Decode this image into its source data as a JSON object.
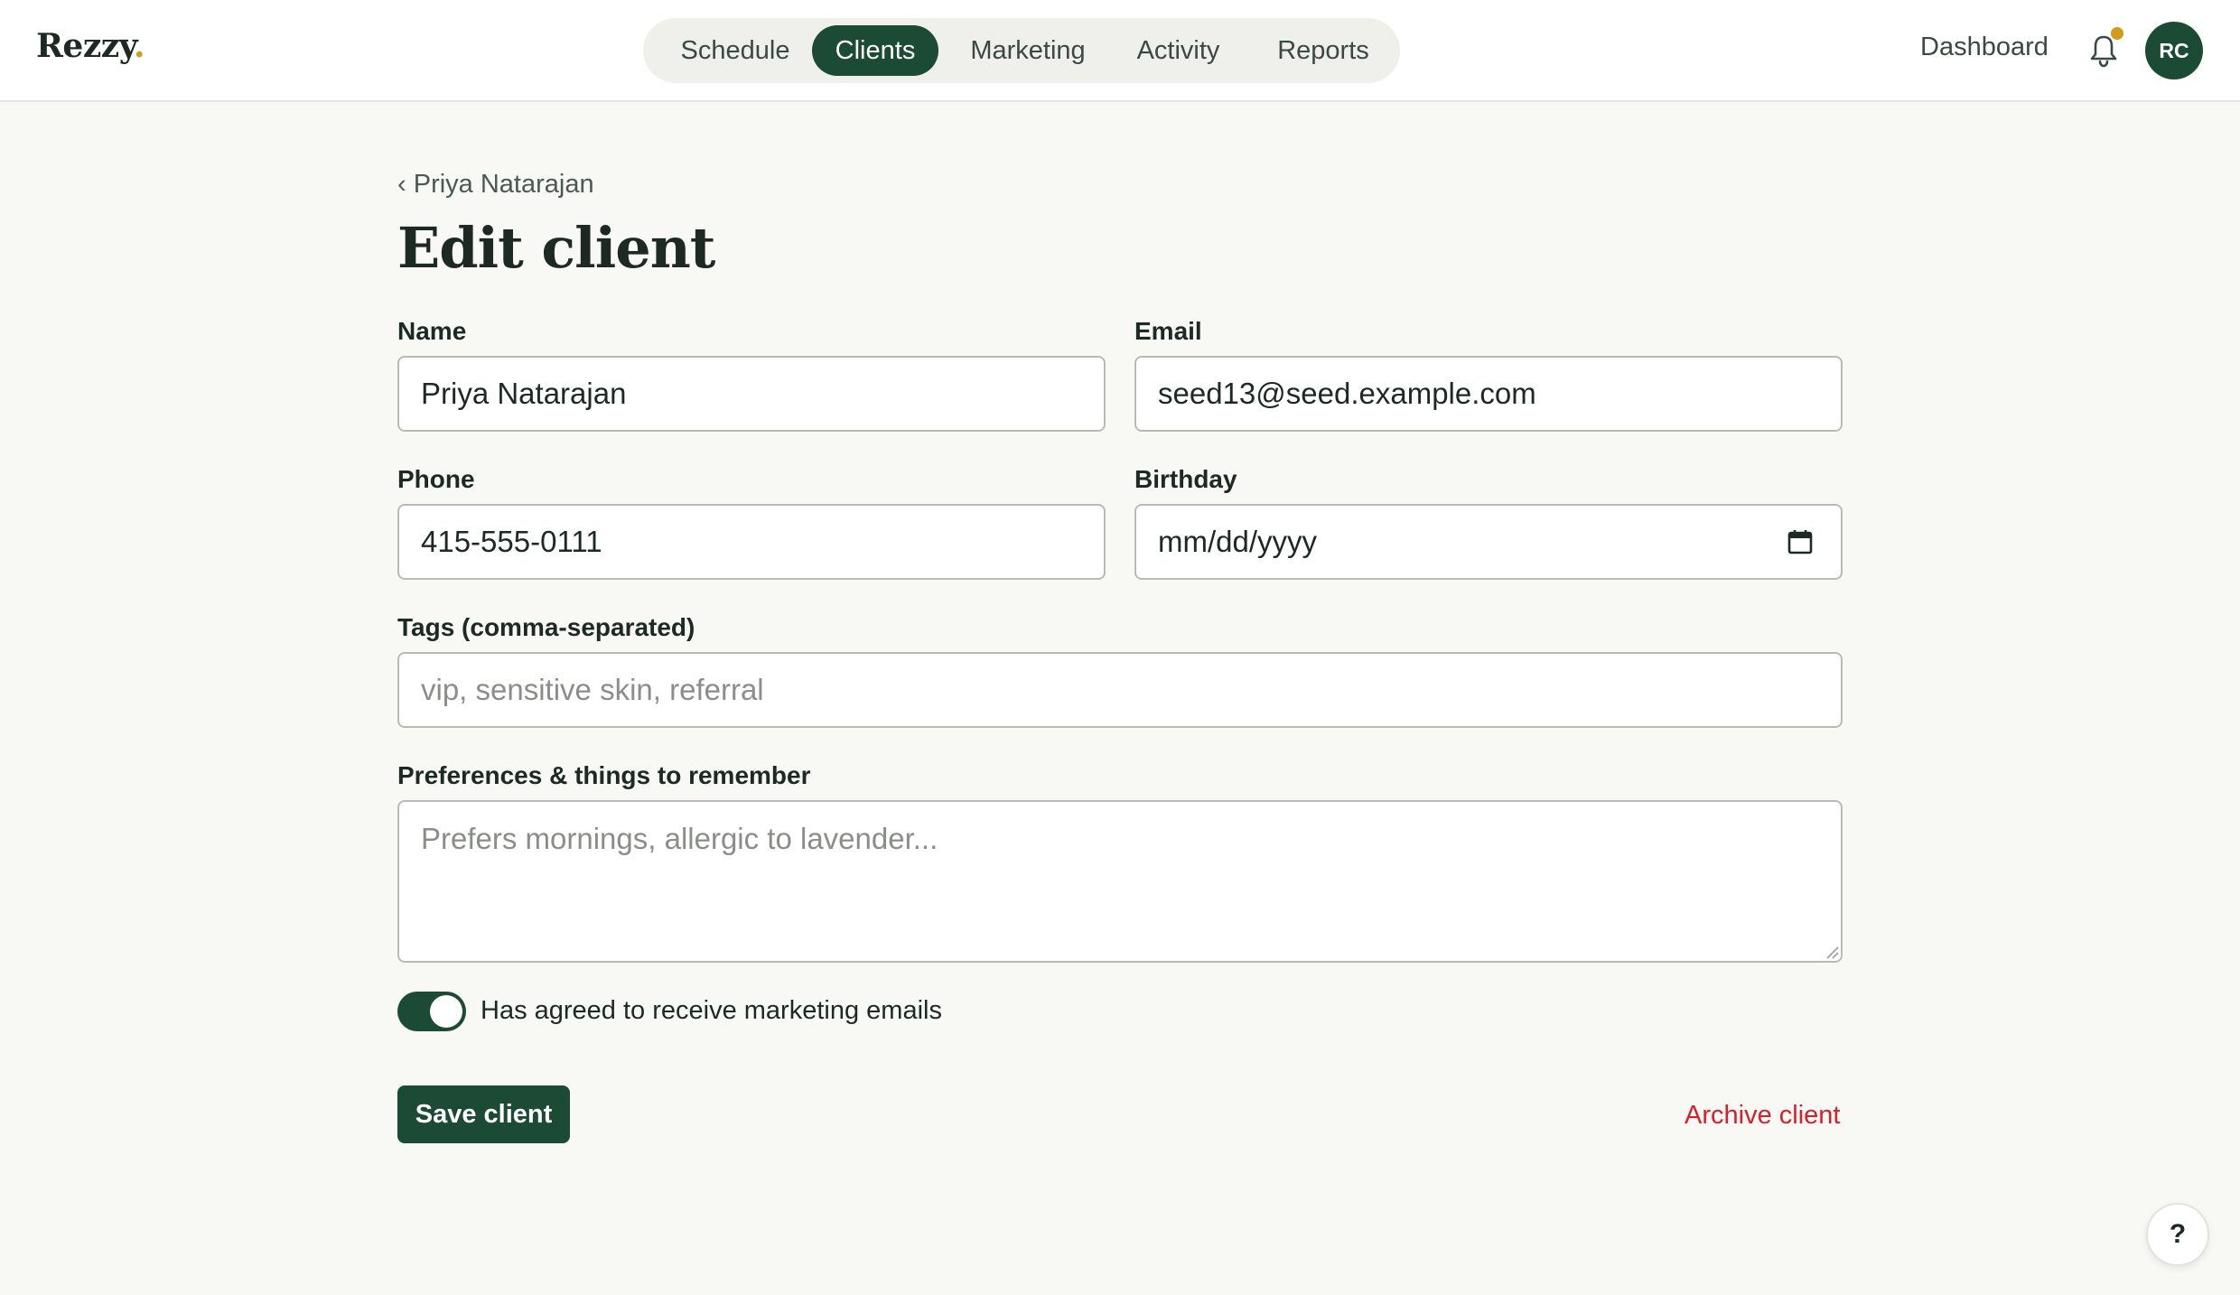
{
  "app": {
    "logo_text": "Rezzy",
    "logo_dot": "."
  },
  "nav": {
    "items": [
      {
        "label": "Schedule",
        "active": false
      },
      {
        "label": "Clients",
        "active": true
      },
      {
        "label": "Marketing",
        "active": false
      },
      {
        "label": "Activity",
        "active": false
      },
      {
        "label": "Reports",
        "active": false
      }
    ],
    "dashboard_label": "Dashboard",
    "notifications_icon": "bell-icon",
    "has_unread_notifications": true,
    "avatar_initials": "RC"
  },
  "page": {
    "back_glyph": "‹",
    "back_label": "Priya Natarajan",
    "title": "Edit client"
  },
  "form": {
    "name": {
      "label": "Name",
      "value": "Priya Natarajan"
    },
    "email": {
      "label": "Email",
      "value": "seed13@seed.example.com"
    },
    "phone": {
      "label": "Phone",
      "value": "415-555-0111"
    },
    "birthday": {
      "label": "Birthday",
      "placeholder": "mm/dd/yyyy",
      "value": "",
      "icon": "calendar-icon"
    },
    "tags": {
      "label": "Tags (comma-separated)",
      "placeholder": "vip, sensitive skin, referral",
      "value": ""
    },
    "preferences": {
      "label": "Preferences & things to remember",
      "placeholder": "Prefers mornings, allergic to lavender...",
      "value": ""
    },
    "marketing_opt_in": {
      "label": "Has agreed to receive marketing emails",
      "checked": true
    },
    "save_label": "Save client",
    "archive_label": "Archive client"
  },
  "help": {
    "label": "?"
  },
  "colors": {
    "brand": "#1b4a35",
    "accent": "#d39a1c",
    "danger": "#d6202a",
    "background": "#f8f8f5"
  }
}
